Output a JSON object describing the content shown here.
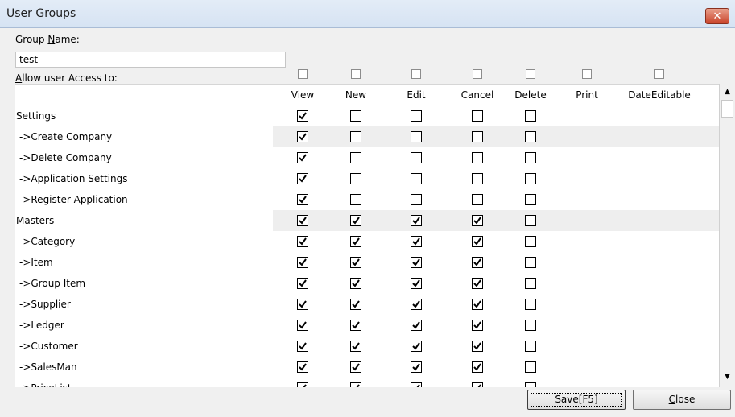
{
  "window": {
    "title": "User Groups"
  },
  "labels": {
    "group_name": "Group Name:",
    "group_name_mnemonic": "N",
    "allow_access": "Allow user Access to:",
    "allow_access_mnemonic": "A"
  },
  "group_name_value": "test",
  "columns": [
    "View",
    "New",
    "Edit",
    "Cancel",
    "Delete",
    "Print",
    "DateEditable"
  ],
  "rows": [
    {
      "label": "Settings",
      "alt": false,
      "checks": [
        true,
        false,
        false,
        false,
        false
      ]
    },
    {
      "label": " ->Create Company",
      "alt": true,
      "checks": [
        true,
        false,
        false,
        false,
        false
      ]
    },
    {
      "label": " ->Delete Company",
      "alt": false,
      "checks": [
        true,
        false,
        false,
        false,
        false
      ]
    },
    {
      "label": " ->Application Settings",
      "alt": false,
      "checks": [
        true,
        false,
        false,
        false,
        false
      ]
    },
    {
      "label": " ->Register Application",
      "alt": false,
      "checks": [
        true,
        false,
        false,
        false,
        false
      ]
    },
    {
      "label": "Masters",
      "alt": true,
      "checks": [
        true,
        true,
        true,
        true,
        false
      ]
    },
    {
      "label": " ->Category",
      "alt": false,
      "checks": [
        true,
        true,
        true,
        true,
        false
      ]
    },
    {
      "label": " ->Item",
      "alt": false,
      "checks": [
        true,
        true,
        true,
        true,
        false
      ]
    },
    {
      "label": " ->Group Item",
      "alt": false,
      "checks": [
        true,
        true,
        true,
        true,
        false
      ]
    },
    {
      "label": " ->Supplier",
      "alt": false,
      "checks": [
        true,
        true,
        true,
        true,
        false
      ]
    },
    {
      "label": " ->Ledger",
      "alt": false,
      "checks": [
        true,
        true,
        true,
        true,
        false
      ]
    },
    {
      "label": " ->Customer",
      "alt": false,
      "checks": [
        true,
        true,
        true,
        true,
        false
      ]
    },
    {
      "label": " ->SalesMan",
      "alt": false,
      "checks": [
        true,
        true,
        true,
        true,
        false
      ]
    },
    {
      "label": " ->PriceList",
      "alt": false,
      "checks": [
        true,
        true,
        true,
        true,
        false
      ]
    }
  ],
  "buttons": {
    "save": "Save[F5]",
    "close": "Close",
    "close_mnemonic": "C"
  },
  "icons": {
    "close": "close-icon",
    "scroll_up": "arrow-up-icon",
    "scroll_down": "arrow-down-icon",
    "check": "checkmark-icon"
  }
}
